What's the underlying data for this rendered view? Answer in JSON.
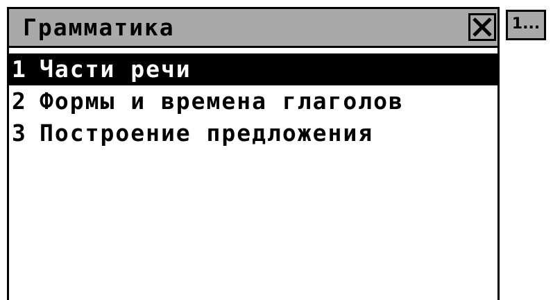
{
  "window": {
    "title": "Грамматика",
    "close_icon": "close-x-icon"
  },
  "side_tab": {
    "label": "1..."
  },
  "menu": {
    "items": [
      {
        "number": "1",
        "label": "Части речи",
        "selected": true
      },
      {
        "number": "2",
        "label": "Формы и времена глаголов",
        "selected": false
      },
      {
        "number": "3",
        "label": "Построение предложения",
        "selected": false
      }
    ]
  },
  "colors": {
    "titlebar": "#a9a9a9",
    "selection": "#000000",
    "background": "#ffffff"
  }
}
